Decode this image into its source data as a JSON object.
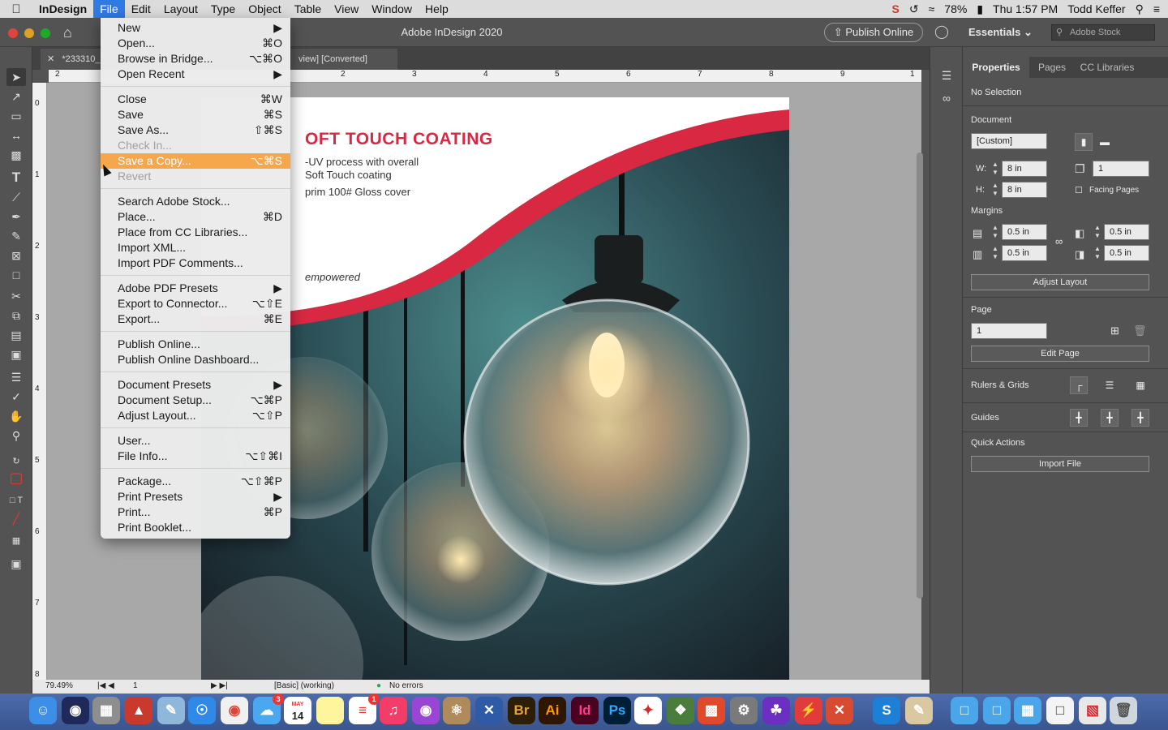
{
  "menubar": {
    "app_name": "InDesign",
    "items": [
      "File",
      "Edit",
      "Layout",
      "Type",
      "Object",
      "Table",
      "View",
      "Window",
      "Help"
    ],
    "active_item": "File",
    "battery": "78%",
    "clock": "Thu 1:57 PM",
    "user": "Todd Keffer"
  },
  "appbar": {
    "title": "Adobe InDesign 2020",
    "publish_label": "Publish Online",
    "workspace": "Essentials",
    "stock_placeholder": "Adobe Stock"
  },
  "document": {
    "tab_title": "*233310_",
    "tab_title_suffix": "view] [Converted]",
    "headline": "OFT TOUCH COATING",
    "body_lines": [
      "-UV process with overall",
      "Soft Touch coating",
      "prim 100# Gloss cover"
    ],
    "logo_text": "empowered",
    "ruler_h": [
      "2",
      "2",
      "3",
      "4",
      "5",
      "6",
      "7",
      "8",
      "9",
      "1"
    ],
    "ruler_v": [
      "0",
      "1",
      "2",
      "3",
      "4",
      "5",
      "6",
      "7",
      "8"
    ]
  },
  "statusbar": {
    "zoom": "79.49%",
    "page": "1",
    "preflight_profile": "[Basic] (working)",
    "errors": "No errors"
  },
  "file_menu": {
    "items": [
      {
        "label": "New",
        "shortcut": "▶",
        "state": "normal"
      },
      {
        "label": "Open...",
        "shortcut": "⌘O",
        "state": "normal"
      },
      {
        "label": "Browse in Bridge...",
        "shortcut": "⌥⌘O",
        "state": "normal"
      },
      {
        "label": "Open Recent",
        "shortcut": "▶",
        "state": "normal"
      },
      {
        "label": "Close",
        "shortcut": "⌘W",
        "state": "normal"
      },
      {
        "label": "Save",
        "shortcut": "⌘S",
        "state": "normal"
      },
      {
        "label": "Save As...",
        "shortcut": "⇧⌘S",
        "state": "normal"
      },
      {
        "label": "Check In...",
        "shortcut": "",
        "state": "disabled"
      },
      {
        "label": "Save a Copy...",
        "shortcut": "⌥⌘S",
        "state": "highlighted"
      },
      {
        "label": "Revert",
        "shortcut": "",
        "state": "disabled"
      },
      {
        "label": "Search Adobe Stock...",
        "shortcut": "",
        "state": "normal"
      },
      {
        "label": "Place...",
        "shortcut": "⌘D",
        "state": "normal"
      },
      {
        "label": "Place from CC Libraries...",
        "shortcut": "",
        "state": "normal"
      },
      {
        "label": "Import XML...",
        "shortcut": "",
        "state": "normal"
      },
      {
        "label": "Import PDF Comments...",
        "shortcut": "",
        "state": "normal"
      },
      {
        "label": "Adobe PDF Presets",
        "shortcut": "▶",
        "state": "normal"
      },
      {
        "label": "Export to Connector...",
        "shortcut": "⌥⇧E",
        "state": "normal"
      },
      {
        "label": "Export...",
        "shortcut": "⌘E",
        "state": "normal"
      },
      {
        "label": "Publish Online...",
        "shortcut": "",
        "state": "normal"
      },
      {
        "label": "Publish Online Dashboard...",
        "shortcut": "",
        "state": "normal"
      },
      {
        "label": "Document Presets",
        "shortcut": "▶",
        "state": "normal"
      },
      {
        "label": "Document Setup...",
        "shortcut": "⌥⌘P",
        "state": "normal"
      },
      {
        "label": "Adjust Layout...",
        "shortcut": "⌥⇧P",
        "state": "normal"
      },
      {
        "label": "User...",
        "shortcut": "",
        "state": "normal"
      },
      {
        "label": "File Info...",
        "shortcut": "⌥⇧⌘I",
        "state": "normal"
      },
      {
        "label": "Package...",
        "shortcut": "⌥⇧⌘P",
        "state": "normal"
      },
      {
        "label": "Print Presets",
        "shortcut": "▶",
        "state": "normal"
      },
      {
        "label": "Print...",
        "shortcut": "⌘P",
        "state": "normal"
      },
      {
        "label": "Print Booklet...",
        "shortcut": "",
        "state": "normal"
      }
    ]
  },
  "properties": {
    "tabs": [
      "Properties",
      "Pages",
      "CC Libraries"
    ],
    "active_tab": "Properties",
    "selection": "No Selection",
    "document_label": "Document",
    "preset": "[Custom]",
    "width_label": "W:",
    "width": "8 in",
    "height_label": "H:",
    "height": "8 in",
    "pages_count": "1",
    "facing_pages": "Facing Pages",
    "margins_label": "Margins",
    "margin_top": "0.5 in",
    "margin_bottom": "0.5 in",
    "margin_left": "0.5 in",
    "margin_right": "0.5 in",
    "adjust_layout": "Adjust Layout",
    "page_label": "Page",
    "page_value": "1",
    "edit_page": "Edit Page",
    "rulers_grids": "Rulers & Grids",
    "guides": "Guides",
    "quick_actions": "Quick Actions",
    "import_file": "Import File"
  },
  "dock": {
    "labeled_apps": [
      "Br",
      "Ai",
      "Id",
      "Ps"
    ],
    "calendar_month": "MAY",
    "calendar_day": "14",
    "badge_messages": "3",
    "badge_reminders": "1"
  },
  "colors": {
    "accent_red": "#d92842",
    "menu_highlight": "#f6a64b",
    "mac_blue": "#2f7ae5"
  }
}
